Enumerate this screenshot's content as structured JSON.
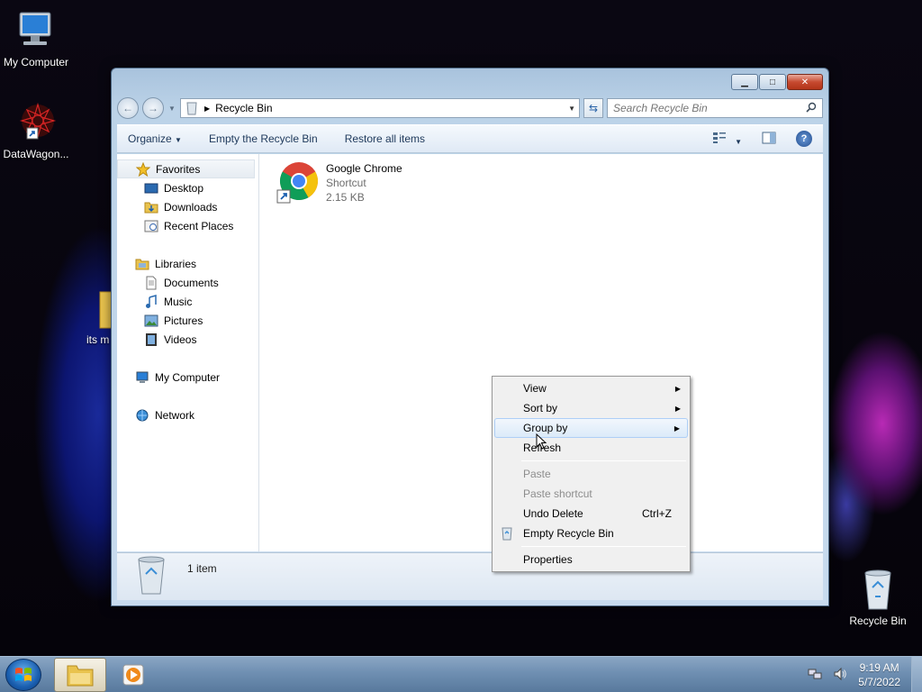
{
  "desktop": {
    "icons": [
      {
        "label": "My Computer",
        "icon": "computer-icon"
      },
      {
        "label": "DataWagon...",
        "icon": "datawagon-shortcut-icon"
      },
      {
        "label": "its m",
        "icon": "folder-icon"
      },
      {
        "label": "Recycle Bin",
        "icon": "recycle-bin-icon"
      }
    ]
  },
  "window": {
    "address": {
      "path": "Recycle Bin"
    },
    "search": {
      "placeholder": "Search Recycle Bin"
    },
    "commands": {
      "organize": "Organize",
      "empty": "Empty the Recycle Bin",
      "restore": "Restore all items"
    },
    "nav": {
      "favorites": "Favorites",
      "desktop": "Desktop",
      "downloads": "Downloads",
      "recent": "Recent Places",
      "libraries": "Libraries",
      "documents": "Documents",
      "music": "Music",
      "pictures": "Pictures",
      "videos": "Videos",
      "computer": "My Computer",
      "network": "Network"
    },
    "file": {
      "name": "Google Chrome",
      "type": "Shortcut",
      "size": "2.15 KB"
    },
    "status": {
      "count": "1 item"
    }
  },
  "context_menu": {
    "view": "View",
    "sort_by": "Sort by",
    "group_by": "Group by",
    "refresh": "Refresh",
    "paste": "Paste",
    "paste_shortcut": "Paste shortcut",
    "undo_delete": "Undo Delete",
    "undo_shortcut": "Ctrl+Z",
    "empty_recycle_bin": "Empty Recycle Bin",
    "properties": "Properties"
  },
  "taskbar": {
    "time": "9:19 AM",
    "date": "5/7/2022"
  },
  "colors": {
    "accent": "#1e395b",
    "menu_hover": "#dbeaf9"
  }
}
